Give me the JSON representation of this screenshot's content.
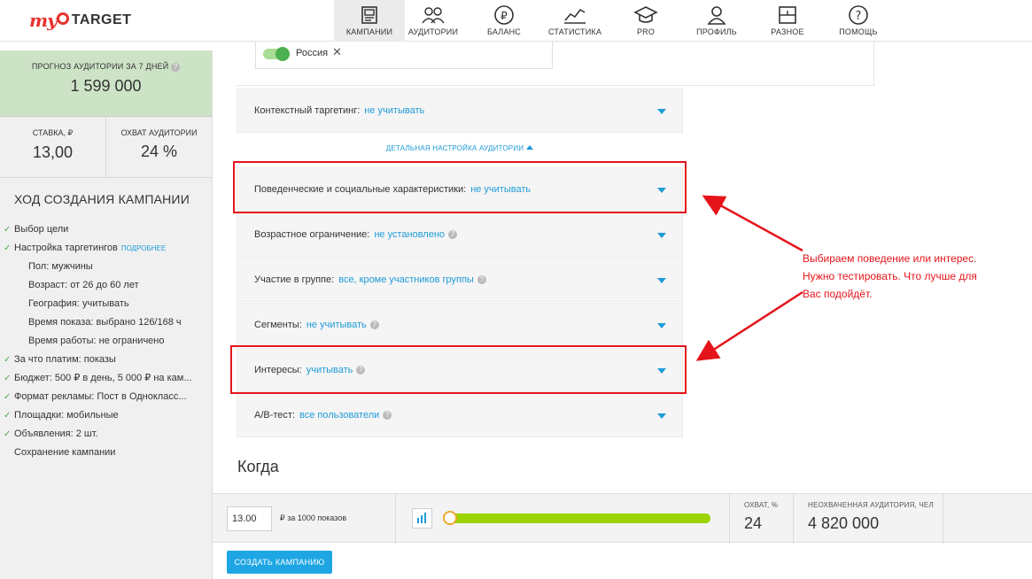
{
  "brand": {
    "my": "my",
    "target": "TARGET"
  },
  "nav": [
    {
      "label": "КАМПАНИИ",
      "icon": "campaigns-icon",
      "active": true
    },
    {
      "label": "АУДИТОРИИ",
      "icon": "audiences-icon"
    },
    {
      "label": "БАЛАНС",
      "icon": "balance-icon"
    },
    {
      "label": "СТАТИСТИКА",
      "icon": "statistics-icon"
    },
    {
      "label": "PRO",
      "icon": "pro-icon"
    },
    {
      "label": "ПРОФИЛЬ",
      "icon": "profile-icon"
    },
    {
      "label": "РАЗНОЕ",
      "icon": "misc-icon"
    },
    {
      "label": "ПОМОЩЬ",
      "icon": "help-icon"
    }
  ],
  "sidebar": {
    "forecast_title": "ПРОГНОЗ АУДИТОРИИ ЗА 7 ДНЕЙ",
    "forecast_value": "1 599 000",
    "bid_label": "СТАВКА, ₽",
    "bid_value": "13,00",
    "reach_label": "ОХВАТ АУДИТОРИИ",
    "reach_value": "24 %",
    "steps_title": "ХОД СОЗДАНИЯ КАМПАНИИ",
    "more_link": "ПОДРОБНЕЕ",
    "steps": [
      "Выбор цели",
      "Настройка таргетингов",
      "Пол: мужчины",
      "Возраст: от 26 до 60 лет",
      "География: учитывать",
      "Время показа: выбрано 126/168 ч",
      "Время работы: не ограничено",
      "За что платим: показы",
      "Бюджет: 500 ₽ в день, 5 000 ₽ на кам...",
      "Формат рекламы: Пост в Однокласс...",
      "Площадки: мобильные",
      "Объявления: 2 шт.",
      "Сохранение кампании"
    ]
  },
  "geo": {
    "label": "Россия",
    "remove": "✕"
  },
  "targeting": {
    "context": {
      "label": "Контекстный таргетинг:",
      "value": "не учитывать"
    },
    "detail_link": "ДЕТАЛЬНАЯ НАСТРОЙКА АУДИТОРИИ",
    "behavior": {
      "label": "Поведенческие и социальные характеристики:",
      "value": "не учитывать"
    },
    "age": {
      "label": "Возрастное ограничение:",
      "value": "не установлено"
    },
    "groups": {
      "label": "Участие в группе:",
      "value": "все, кроме участников группы"
    },
    "segments": {
      "label": "Сегменты:",
      "value": "не учитывать"
    },
    "interests": {
      "label": "Интересы:",
      "value": "учитывать"
    },
    "abtest": {
      "label": "А/В-тест:",
      "value": "все пользователи"
    }
  },
  "when_title": "Когда",
  "annotation": "Выбираем поведение или интерес. Нужно тестировать. Что лучше для Вас подойдёт.",
  "bottom": {
    "bid_input": "13.00",
    "bid_unit": "₽ за 1000 показов",
    "slider_fraction": 1.0,
    "reach_label": "ОХВАТ, %",
    "reach_value": "24",
    "uncovered_label": "НЕОХВАЧЕННАЯ АУДИТОРИЯ, ЧЕЛ",
    "uncovered_value": "4 820 000"
  },
  "create_button": "СОЗДАТЬ КАМПАНИЮ",
  "colors": {
    "accent": "#1e9bd8",
    "brand_red": "#e8322e",
    "annotation_red": "#e5141b",
    "forecast_bg": "#cde3c6"
  }
}
